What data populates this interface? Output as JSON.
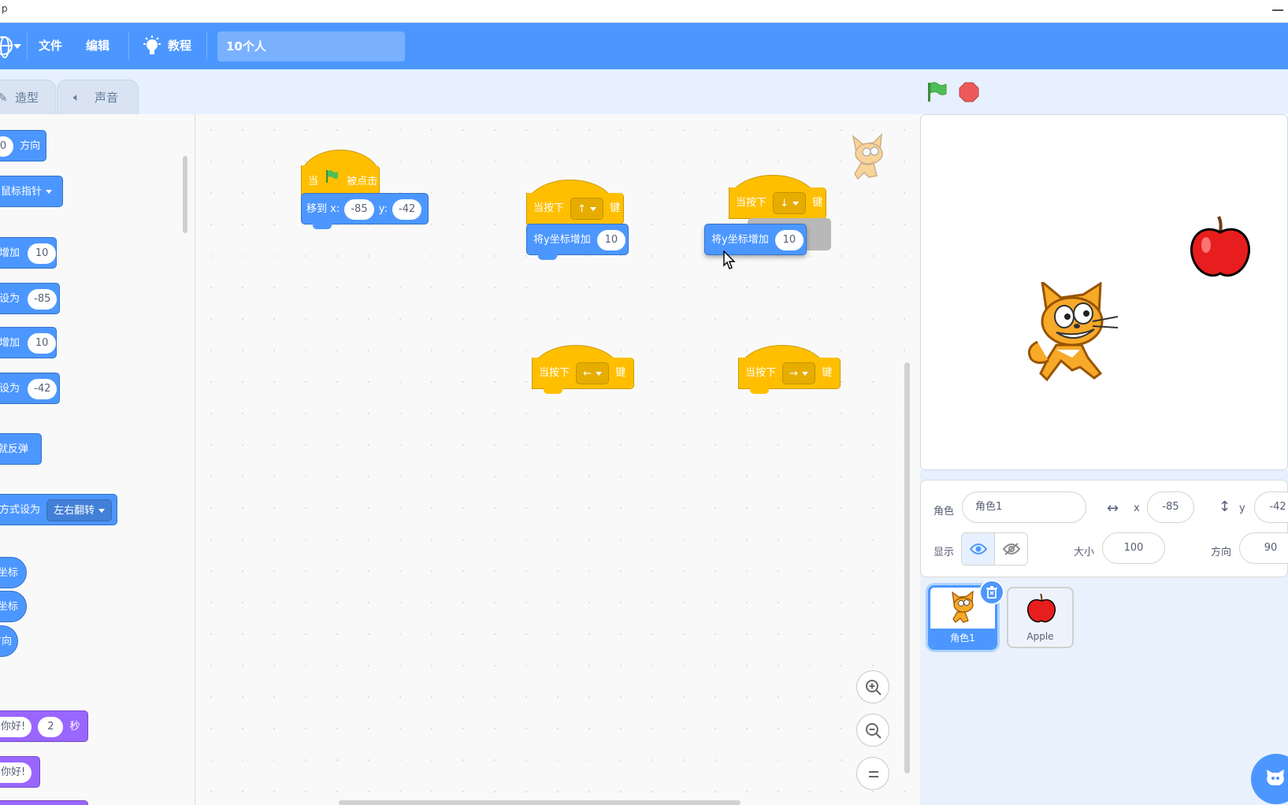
{
  "menubar": {
    "file": "文件",
    "edit": "编辑",
    "tutorials": "教程",
    "project_title": "10个人"
  },
  "tabs": {
    "costumes": "造型",
    "sounds": "声音"
  },
  "palette": {
    "point_direction_suffix": "方向",
    "point_direction_value": "0",
    "mouse_pointer": "鼠标指针",
    "change_x_prefix": "增加",
    "change_x_value": "10",
    "set_x_prefix": "设为",
    "set_x_value": "-85",
    "change_y_prefix": "增加",
    "change_y_value": "10",
    "set_y_prefix": "设为",
    "set_y_value": "-42",
    "bounce": "碰到边缘就反弹",
    "rotation_style_prefix": "方式设为",
    "rotation_style_value": "左右翻转",
    "x_position": "x 坐标",
    "y_position": "y 坐标",
    "direction": "方向",
    "say_for_prefix": "你好!",
    "say_for_secs": "2",
    "say_for_unit": "秒",
    "say": "你好!"
  },
  "scripts": {
    "flag_hat_when": "当",
    "flag_hat_clicked": "被点击",
    "goto_label": "移到 x:",
    "goto_x": "-85",
    "goto_y_label": "y:",
    "goto_y": "-42",
    "key_hat_prefix": "当按下",
    "key_hat_suffix": "键",
    "key_up": "↑",
    "key_down": "↓",
    "key_left": "←",
    "key_right": "→",
    "change_y_label": "将y坐标增加",
    "change_y_value": "10",
    "dragged_label": "将y坐标增加",
    "dragged_value": "10"
  },
  "sprite_info": {
    "sprite_label": "角色",
    "sprite_name": "角色1",
    "x_label": "x",
    "x_value": "-85",
    "y_label": "y",
    "y_value": "-42",
    "show_label": "显示",
    "size_label": "大小",
    "size_value": "100",
    "direction_label": "方向",
    "direction_value": "90"
  },
  "sprites": [
    {
      "name": "角色1",
      "selected": true
    },
    {
      "name": "Apple",
      "selected": false
    }
  ],
  "colors": {
    "menu_blue": "#4c97ff",
    "motion": "#4c97ff",
    "events": "#ffbf00",
    "looks": "#9966ff",
    "flag_green": "#4cbf56",
    "stop_red": "#ec5959"
  }
}
